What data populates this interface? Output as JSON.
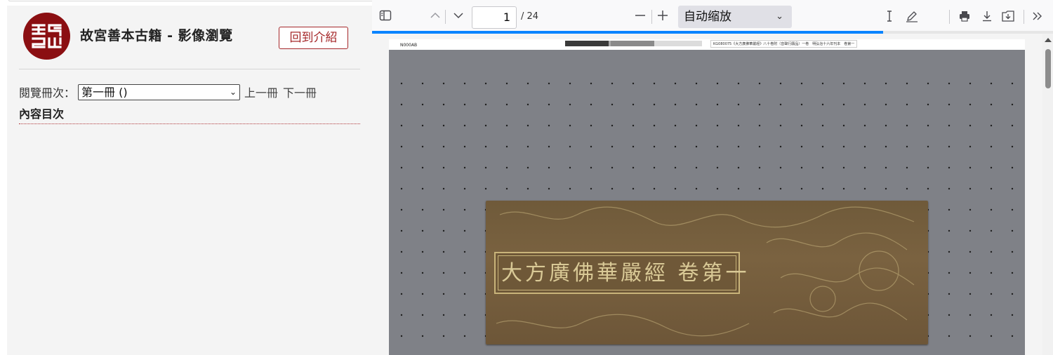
{
  "site": {
    "title": "故宮善本古籍 - 影像瀏覽",
    "back_button": "回到介紹",
    "logo_icon": "palace-museum-logo-icon"
  },
  "volume": {
    "label": "閱覽冊次：",
    "selected": "第一冊 ()",
    "prev": "上一冊",
    "next": "下一冊"
  },
  "toc": {
    "title": "內容目次"
  },
  "pdf_toolbar": {
    "current_page": "1",
    "total_pages": "/ 24",
    "zoom_selected": "自动缩放",
    "icons": [
      "sidebar-toggle-icon",
      "prev-page-icon",
      "next-page-icon",
      "zoom-out-icon",
      "zoom-in-icon",
      "text-cursor-icon",
      "draw-icon",
      "print-icon",
      "download-icon",
      "save-icon",
      "more-tools-icon"
    ],
    "progress_fraction": 0.75
  },
  "document": {
    "header_left": "N000AB",
    "header_right": "KG080075《大方廣佛華嚴經》八十卷附（音聲行願品）一卷　明弘治十六年刊本　卷第一",
    "label_text": "大方廣佛華嚴經 卷第一"
  },
  "colors": {
    "accent_red": "#8b0f12",
    "button_red": "#a5282a",
    "progress_blue": "#0a84ff"
  }
}
